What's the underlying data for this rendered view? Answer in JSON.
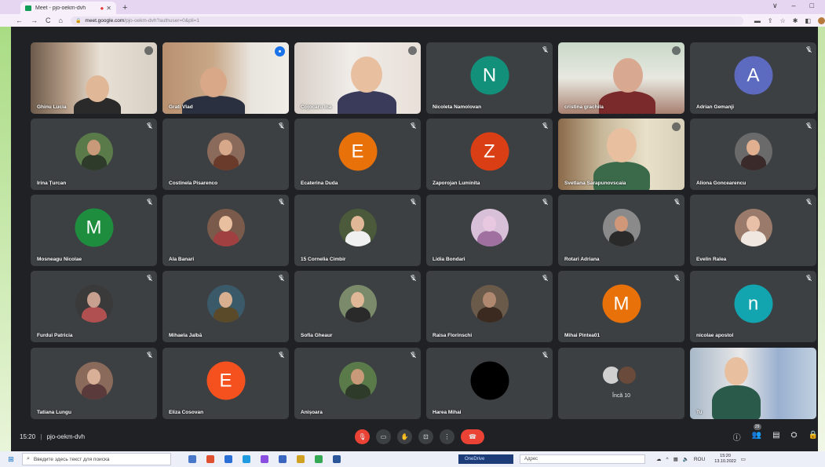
{
  "browser": {
    "tab_title": "Meet - pjo-oekm-dvh",
    "tab_close": "✕",
    "new_tab": "+",
    "url_host": "meet.google.com",
    "url_path": "/pjo-oekm-dvh?authuser=0&pli=1",
    "nav": {
      "back": "←",
      "forward": "→",
      "reload": "C",
      "home": "⌂"
    },
    "window_controls": {
      "chevron": "∨",
      "minimize": "–",
      "maximize": "□"
    }
  },
  "participants": [
    {
      "name": "Ghinu Lucia",
      "kind": "video",
      "mic": "muted-round"
    },
    {
      "name": "Grati Vlad",
      "kind": "video",
      "mic": "speaking"
    },
    {
      "name": "Cojocaru Ina",
      "kind": "video",
      "mic": "round"
    },
    {
      "name": "Nicoleta Namolovan",
      "kind": "letter",
      "letter": "N",
      "color": "#13907a",
      "mic": "muted"
    },
    {
      "name": "cristina grachila",
      "kind": "video",
      "mic": "round"
    },
    {
      "name": "Adrian Gemanji",
      "kind": "letter",
      "letter": "A",
      "color": "#5c6bc0",
      "mic": "muted"
    },
    {
      "name": "Irina Țurcan",
      "kind": "photo",
      "mic": "muted"
    },
    {
      "name": "Costinela Pisarenco",
      "kind": "photo",
      "mic": "muted"
    },
    {
      "name": "Ecaterina Duda",
      "kind": "letter",
      "letter": "E",
      "color": "#e8710a",
      "mic": "muted"
    },
    {
      "name": "Zaporojan Luminita",
      "kind": "letter",
      "letter": "Z",
      "color": "#d93e15",
      "mic": "muted"
    },
    {
      "name": "Svetlana Sarapunovscaia",
      "kind": "video",
      "mic": "round"
    },
    {
      "name": "Aliona Goncearencu",
      "kind": "photo",
      "mic": "muted"
    },
    {
      "name": "Mosneagu Nicolae",
      "kind": "letter",
      "letter": "M",
      "color": "#1e8e3e",
      "mic": "muted"
    },
    {
      "name": "Ala Banari",
      "kind": "photo",
      "mic": "muted"
    },
    {
      "name": "15 Cornelia Cimbir",
      "kind": "photo",
      "mic": "muted"
    },
    {
      "name": "Lidia Bondari",
      "kind": "photo",
      "mic": "muted"
    },
    {
      "name": "Rotari Adriana",
      "kind": "photo",
      "mic": "muted"
    },
    {
      "name": "Evelin Ralea",
      "kind": "photo",
      "mic": "muted"
    },
    {
      "name": "Furdui Patricia",
      "kind": "photo",
      "mic": "muted"
    },
    {
      "name": "Mihaela Jalbă",
      "kind": "photo",
      "mic": "muted"
    },
    {
      "name": "Sofia Gheaur",
      "kind": "photo",
      "mic": "muted"
    },
    {
      "name": "Raisa Florinschi",
      "kind": "photo",
      "mic": "muted"
    },
    {
      "name": "Mihai Pintea01",
      "kind": "letter",
      "letter": "M",
      "color": "#e8710a",
      "mic": "muted"
    },
    {
      "name": "nicolae apostol",
      "kind": "letter",
      "letter": "n",
      "color": "#12a4af",
      "mic": "muted"
    },
    {
      "name": "Tatiana Lungu",
      "kind": "photo",
      "mic": "muted"
    },
    {
      "name": "Eliza Cosovan",
      "kind": "letter",
      "letter": "E",
      "color": "#f4511e",
      "mic": "muted"
    },
    {
      "name": "Anișoara",
      "kind": "photo",
      "mic": "muted"
    },
    {
      "name": "Harea Mihai",
      "kind": "letter",
      "letter": "",
      "color": "#000000",
      "mic": "muted"
    },
    {
      "name": "",
      "kind": "more",
      "label": "Încă 10",
      "mic": "none"
    },
    {
      "name": "Tu",
      "kind": "video",
      "mic": "none"
    }
  ],
  "photo_palettes": [
    [
      "#5a7a4a",
      "#c99a7a",
      "#2e3b2a"
    ],
    [
      "#8a6a5a",
      "#d8a88a",
      "#6a3a2a"
    ],
    [
      "#6a6a6a",
      "#e0b090",
      "#3a2a2a"
    ],
    [
      "#7a5a4a",
      "#e8c0a0",
      "#a04040"
    ],
    [
      "#4a5a3a",
      "#e0b898",
      "#f0f0f0"
    ],
    [
      "#d8c0d8",
      "#e8c8e0",
      "#a070a0"
    ],
    [
      "#8a8a8a",
      "#d09878",
      "#2a2a2a"
    ],
    [
      "#9a7a6a",
      "#e8c0a8",
      "#f0e8e0"
    ],
    [
      "#3a3a3a",
      "#c8a090",
      "#b05050"
    ],
    [
      "#3a5a6a",
      "#d8b090",
      "#5a4a2a"
    ],
    [
      "#7a8a6a",
      "#e0b898",
      "#2a2a2a"
    ],
    [
      "#6a5a4a",
      "#b08870",
      "#3a2a20"
    ],
    [
      "#8a6a5a",
      "#d8b098",
      "#5a3a3a"
    ]
  ],
  "more": {
    "label": "Încă 10"
  },
  "meeting": {
    "time": "15:20",
    "separator": "|",
    "code": "pjo-oekm-dvh"
  },
  "controls": {
    "mic": "🎙",
    "camera": "▭",
    "raise_hand": "✋",
    "present": "⊡",
    "more": "⋮",
    "end": "☎"
  },
  "right_controls": {
    "info": "ⓘ",
    "people": "👥",
    "people_count": "29",
    "chat": "▤",
    "activities": "⛭",
    "lock": "🔒"
  },
  "taskbar": {
    "search_placeholder": "Введите здесь текст для поиска",
    "onedrive": "OneDrive",
    "address": "Адрес",
    "lang": "ROU",
    "clock_time": "15:20",
    "clock_date": "13.10.2022"
  }
}
